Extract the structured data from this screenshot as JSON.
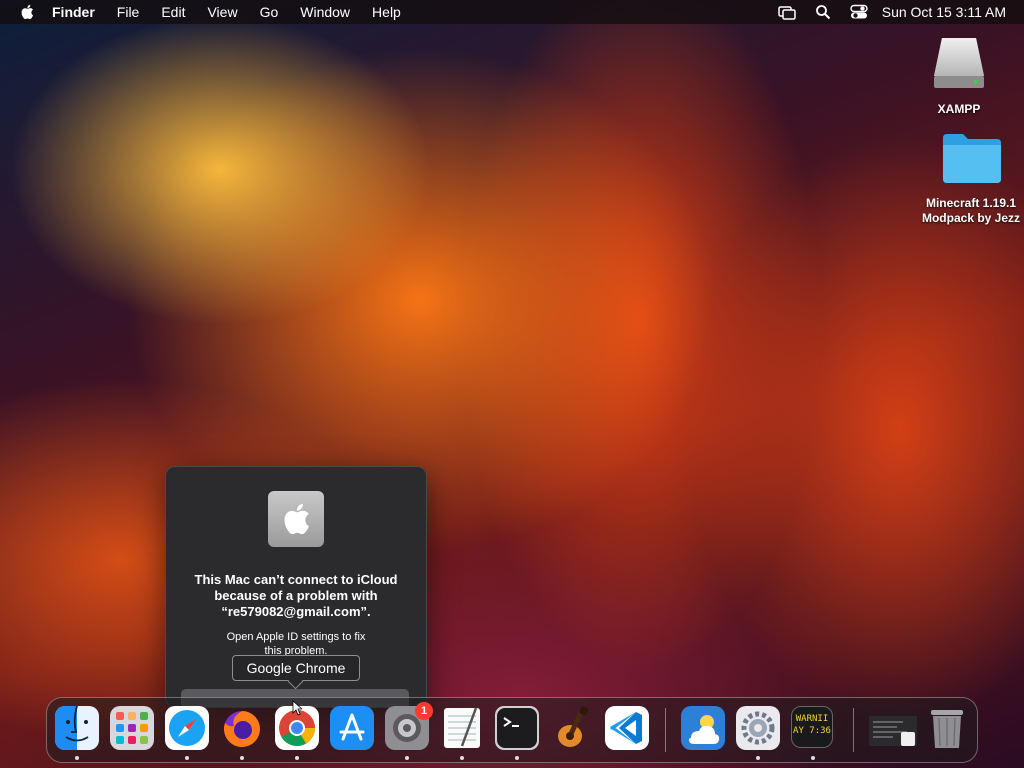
{
  "menubar": {
    "app_name": "Finder",
    "menus": [
      "File",
      "Edit",
      "View",
      "Go",
      "Window",
      "Help"
    ],
    "clock": "Sun Oct 15  3:11 AM",
    "status_icons": [
      "screen-mirroring-icon",
      "search-icon",
      "control-center-icon"
    ]
  },
  "desktop": {
    "icons": [
      {
        "label": "XAMPP",
        "icon": "drive-icon"
      },
      {
        "label_line1": "Minecraft 1.19.1",
        "label_line2": "Modpack by Jezz",
        "icon": "folder-icon"
      }
    ]
  },
  "notification": {
    "title_line1": "This Mac can’t connect to iCloud",
    "title_line2": "because of a problem with",
    "title_line3": "“re579082@gmail.com”.",
    "body_line1": "Open Apple ID settings to fix",
    "body_line2": "this problem."
  },
  "tooltip": {
    "label": "Google Chrome"
  },
  "dock": {
    "apps": [
      {
        "name": "finder"
      },
      {
        "name": "launchpad"
      },
      {
        "name": "safari"
      },
      {
        "name": "firefox"
      },
      {
        "name": "chrome"
      },
      {
        "name": "app-store"
      },
      {
        "name": "system-settings",
        "badge": "1"
      },
      {
        "name": "textedit"
      },
      {
        "name": "terminal"
      },
      {
        "name": "garageband"
      },
      {
        "name": "vscode"
      },
      {
        "name": "weather"
      },
      {
        "name": "system-preferences"
      },
      {
        "name": "console",
        "icon_text_line1": "WARNII",
        "icon_text_line2": "AY 7:36"
      },
      {
        "name": "preview"
      },
      {
        "name": "trash"
      }
    ]
  },
  "colors": {
    "accent": "#0a84ff",
    "badge": "#ff3b30"
  }
}
